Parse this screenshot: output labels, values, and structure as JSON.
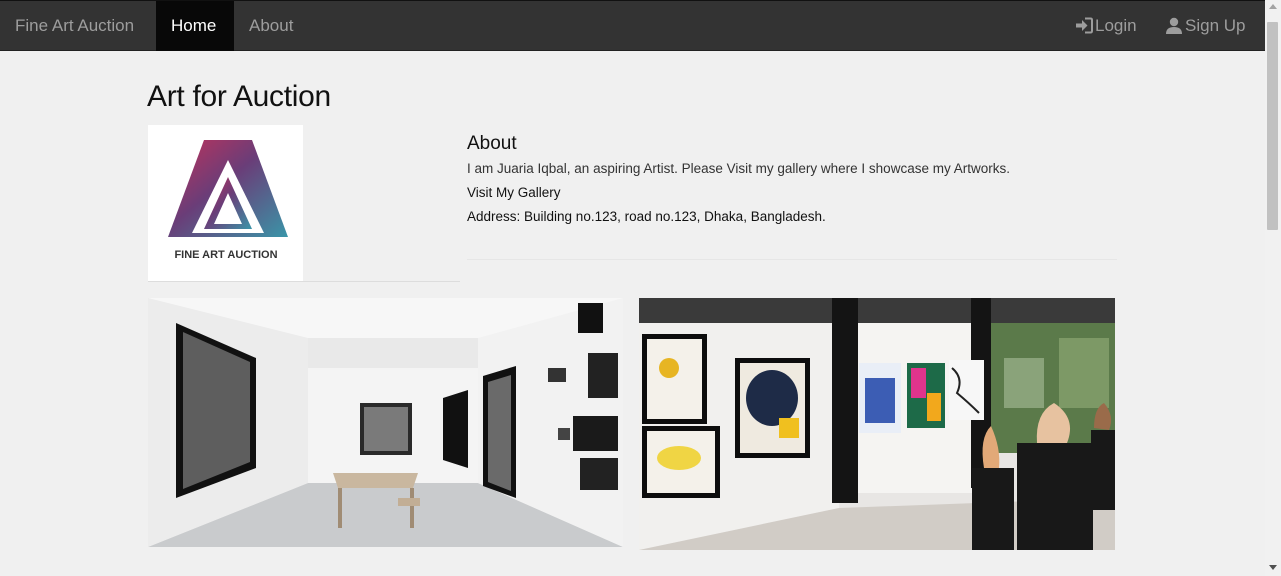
{
  "navbar": {
    "brand": "Fine Art Auction",
    "items": [
      {
        "label": "Home",
        "active": true
      },
      {
        "label": "About",
        "active": false
      }
    ],
    "right_items": [
      {
        "label": "Login",
        "icon": "login-icon"
      },
      {
        "label": "Sign Up",
        "icon": "user-icon"
      }
    ]
  },
  "page": {
    "title": "Art for Auction",
    "logo_text": "FINE ART AUCTION",
    "about": {
      "heading": "About",
      "text": "I am Juaria Iqbal, an aspiring Artist. Please Visit my gallery where I showcase my Artworks.",
      "gallery_link": "Visit My Gallery",
      "address": "Address: Building no.123, road no.123, Dhaka, Bangladesh."
    }
  },
  "colors": {
    "navbar_bg": "#333333",
    "active_bg": "#080808",
    "page_bg": "#f0f0f0"
  }
}
